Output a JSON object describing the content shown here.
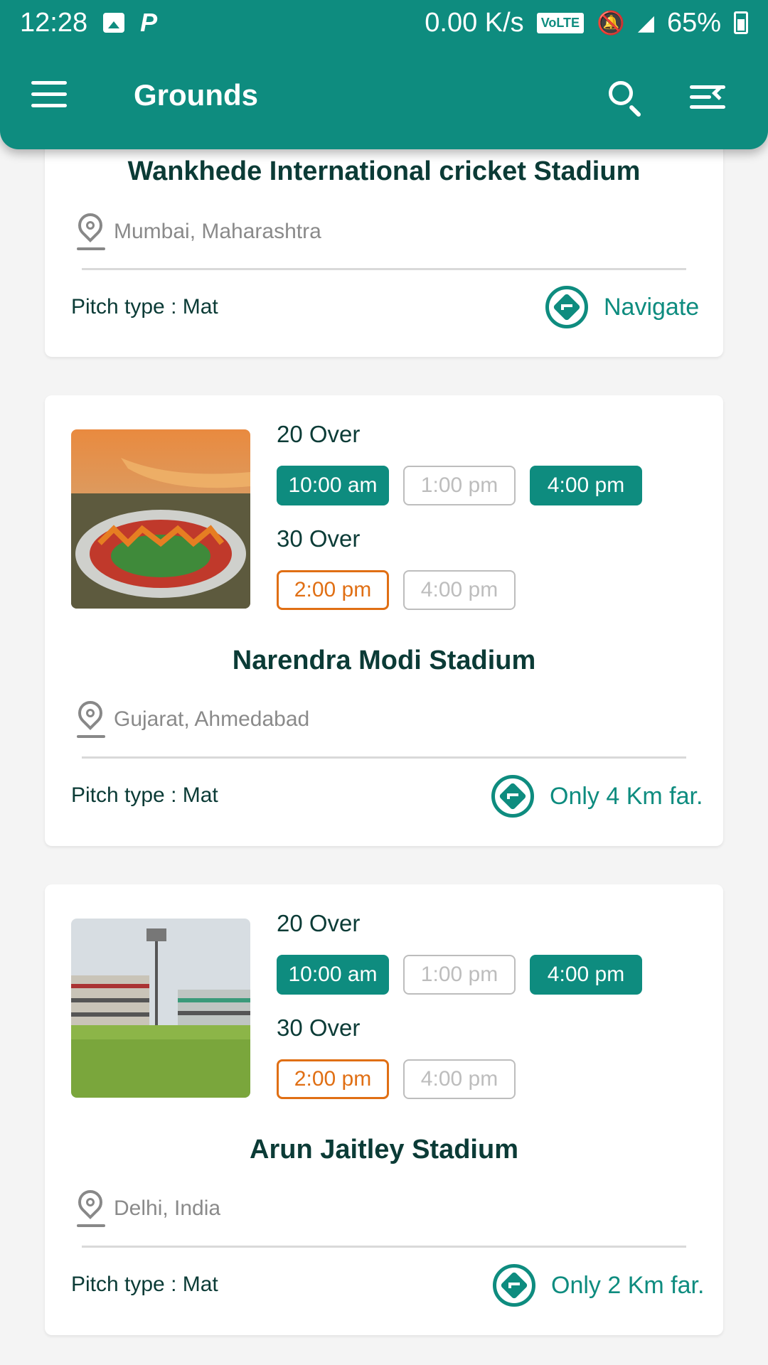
{
  "status_bar": {
    "time": "12:28",
    "net_speed": "0.00 K/s",
    "volte": "VoLTE",
    "network": "4G+",
    "battery": "65%"
  },
  "app_bar": {
    "title": "Grounds"
  },
  "accent_color": "#0e8c7f",
  "booked_color": "#e06f14",
  "grounds": [
    {
      "name": "Wankhede International cricket Stadium",
      "location": "Mumbai, Maharashtra",
      "pitch": "Pitch type : Mat",
      "action": "Navigate"
    },
    {
      "name": "Narendra Modi Stadium",
      "location": "Gujarat, Ahmedabad",
      "pitch": "Pitch type : Mat",
      "action": "Only 4 Km far.",
      "over_20": {
        "label": "20 Over",
        "slots": [
          "10:00 am",
          "1:00 pm",
          "4:00 pm"
        ]
      },
      "over_30": {
        "label": "30 Over",
        "slots": [
          "2:00 pm",
          "4:00 pm"
        ]
      }
    },
    {
      "name": "Arun Jaitley Stadium",
      "location": "Delhi, India",
      "pitch": "Pitch type : Mat",
      "action": "Only 2 Km far.",
      "over_20": {
        "label": "20 Over",
        "slots": [
          "10:00 am",
          "1:00 pm",
          "4:00 pm"
        ]
      },
      "over_30": {
        "label": "30 Over",
        "slots": [
          "2:00 pm",
          "4:00 pm"
        ]
      }
    }
  ]
}
